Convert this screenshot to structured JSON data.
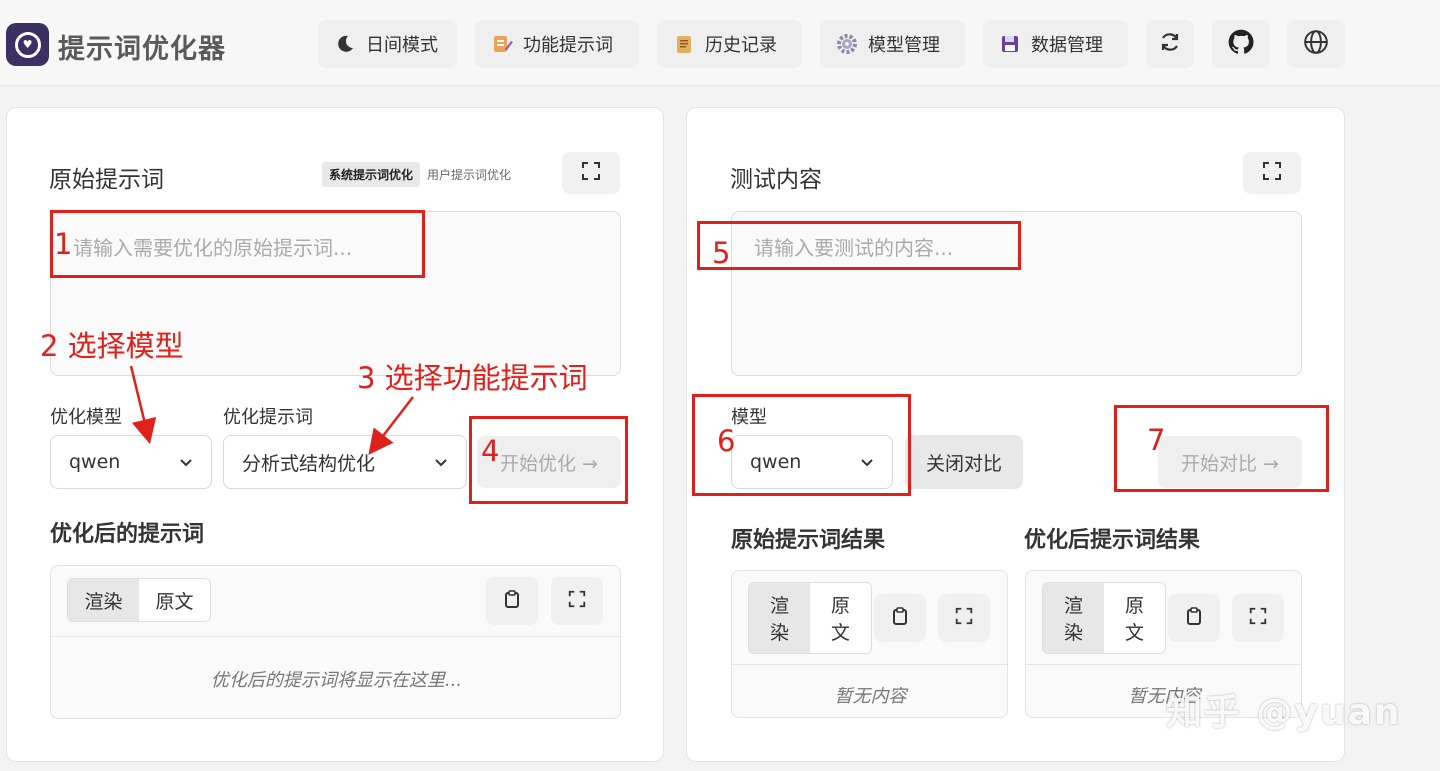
{
  "app": {
    "title": "提示词优化器"
  },
  "nav": {
    "day_mode": "日间模式",
    "function_prompts": "功能提示词",
    "history": "历史记录",
    "model_manage": "模型管理",
    "data_manage": "数据管理"
  },
  "left": {
    "title": "原始提示词",
    "tab_system": "系统提示词优化",
    "tab_user": "用户提示词优化",
    "input_placeholder": "请输入需要优化的原始提示词...",
    "model_label": "优化模型",
    "model_value": "qwen",
    "prompt_label": "优化提示词",
    "prompt_value": "分析式结构优化",
    "start_button": "开始优化 →",
    "output_title": "优化后的提示词",
    "view_render": "渲染",
    "view_raw": "原文",
    "output_placeholder": "优化后的提示词将显示在这里..."
  },
  "right": {
    "title": "测试内容",
    "input_placeholder": "请输入要测试的内容...",
    "model_label": "模型",
    "model_value": "qwen",
    "compare_toggle": "关闭对比",
    "start_compare": "开始对比 →",
    "original_result_title": "原始提示词结果",
    "optimized_result_title": "优化后提示词结果",
    "view_render": "渲染",
    "view_raw": "原文",
    "empty_text": "暂无内容"
  },
  "annotations": {
    "n1": "1",
    "n2_label": "2 选择模型",
    "n3_label": "3 选择功能提示词",
    "n4": "4",
    "n5": "5",
    "n6": "6",
    "n7": "7"
  },
  "watermark": "知乎 @yuan",
  "colors": {
    "annotation": "#e0201a",
    "logo_bg": "#3b2f63"
  }
}
